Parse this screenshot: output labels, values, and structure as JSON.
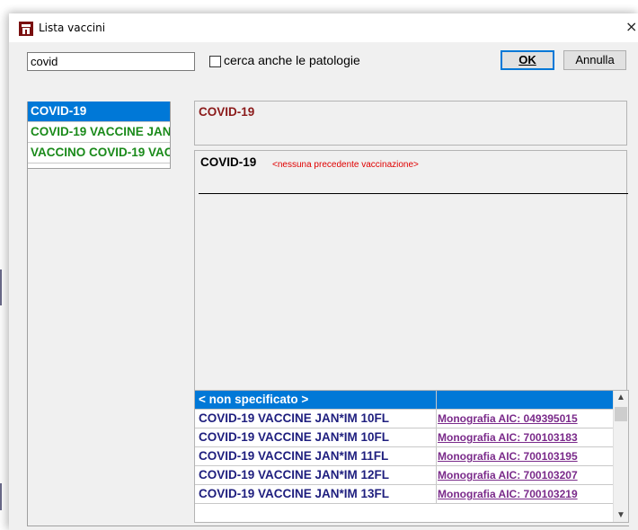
{
  "window": {
    "title": "Lista vaccini",
    "close_glyph": "×"
  },
  "search": {
    "value": "covid"
  },
  "checkbox": {
    "label": "cerca anche le patologie",
    "checked": false
  },
  "buttons": {
    "ok": "OK",
    "cancel": "Annulla"
  },
  "vaccine_list": {
    "items": [
      {
        "label": "COVID-19",
        "selected": true
      },
      {
        "label": "COVID-19 VACCINE JAN",
        "selected": false
      },
      {
        "label": "VACCINO COVID-19 VAC",
        "selected": false
      }
    ]
  },
  "detail": {
    "title": "COVID-19"
  },
  "history": {
    "name": "COVID-19",
    "note": "<nessuna precedente vaccinazione>"
  },
  "products": {
    "rows": [
      {
        "name": "< non specificato >",
        "link": "",
        "selected": true
      },
      {
        "name": "COVID-19 VACCINE JAN*IM 10FL",
        "link": "Monografia AIC: 049395015",
        "selected": false
      },
      {
        "name": "COVID-19 VACCINE JAN*IM 10FL",
        "link": "Monografia AIC: 700103183",
        "selected": false
      },
      {
        "name": "COVID-19 VACCINE JAN*IM 11FL",
        "link": "Monografia AIC: 700103195",
        "selected": false
      },
      {
        "name": "COVID-19 VACCINE JAN*IM 12FL",
        "link": "Monografia AIC: 700103207",
        "selected": false
      },
      {
        "name": "COVID-19 VACCINE JAN*IM 13FL",
        "link": "Monografia AIC: 700103219",
        "selected": false
      }
    ]
  },
  "colors": {
    "selection": "#0078d7",
    "vaccine_text": "#1a8a1a",
    "link": "#7a2a8a",
    "note": "#e00000"
  }
}
